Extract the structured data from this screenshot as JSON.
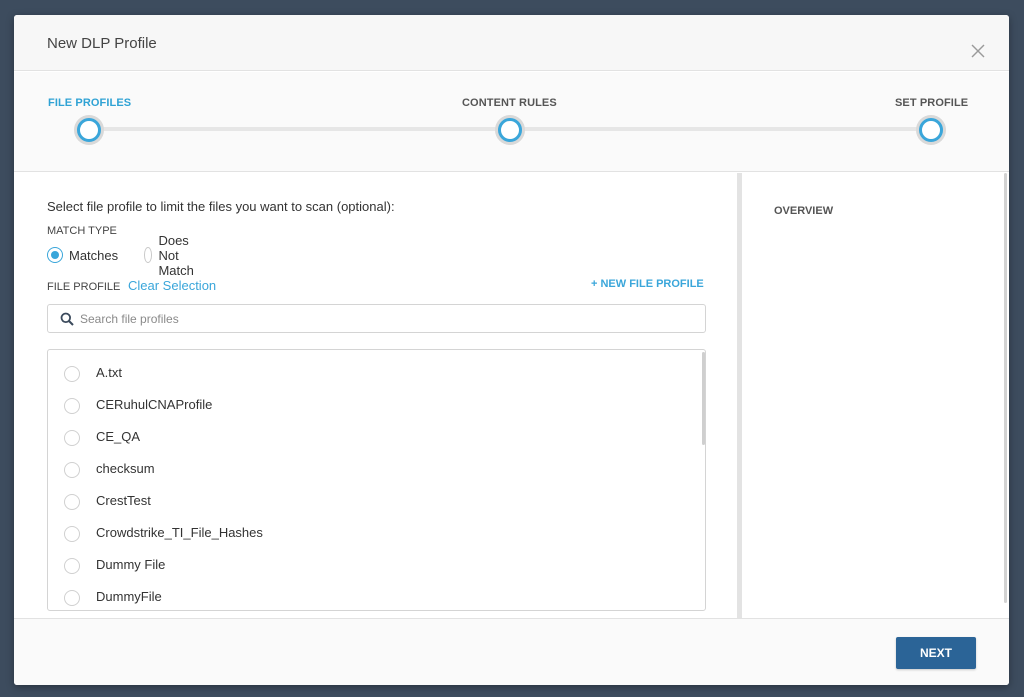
{
  "modal": {
    "title": "New DLP Profile",
    "close_icon": "close-icon"
  },
  "stepper": {
    "steps": [
      {
        "label": "FILE PROFILES",
        "state": "active"
      },
      {
        "label": "CONTENT RULES",
        "state": "inactive"
      },
      {
        "label": "SET PROFILE",
        "state": "inactive"
      }
    ]
  },
  "left": {
    "instructions": "Select file profile to limit the files you want to scan (optional):",
    "match_type_label": "MATCH TYPE",
    "match_options": [
      {
        "label": "Matches",
        "checked": true
      },
      {
        "label": "Does Not Match",
        "checked": false
      }
    ],
    "file_profile_label": "FILE PROFILE",
    "clear_selection": "Clear Selection",
    "new_profile": "+ NEW FILE PROFILE",
    "search": {
      "placeholder": "Search file profiles",
      "value": "",
      "icon": "search-icon"
    },
    "profiles": [
      "A.txt",
      "CERuhulCNAProfile",
      "CE_QA",
      "checksum",
      "CrestTest",
      "Crowdstrike_TI_File_Hashes",
      "Dummy File",
      "DummyFile"
    ]
  },
  "right": {
    "overview_title": "OVERVIEW"
  },
  "footer": {
    "next_label": "NEXT"
  },
  "colors": {
    "accent": "#3aa6da",
    "primary_button": "#2b6497",
    "backdrop": "#3d4c5e"
  }
}
